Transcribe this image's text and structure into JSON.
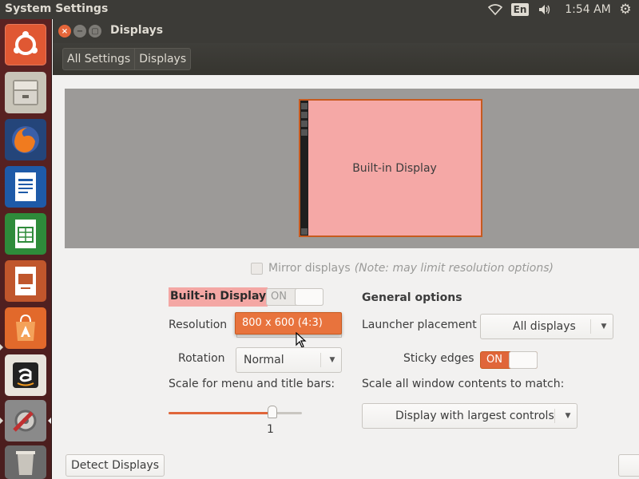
{
  "top_panel": {
    "app_title": "System Settings",
    "language": "En",
    "clock": "1:54 AM",
    "icons": [
      "wifi-icon",
      "volume-icon",
      "power-gear-icon"
    ]
  },
  "launcher": {
    "items": [
      {
        "name": "ubuntu-dash",
        "icon": "ubuntu-logo-icon"
      },
      {
        "name": "files",
        "icon": "file-cabinet-icon"
      },
      {
        "name": "firefox",
        "icon": "firefox-icon"
      },
      {
        "name": "libreoffice-writer",
        "icon": "writer-document-icon"
      },
      {
        "name": "libreoffice-calc",
        "icon": "calc-spreadsheet-icon"
      },
      {
        "name": "libreoffice-impress",
        "icon": "impress-presentation-icon"
      },
      {
        "name": "ubuntu-software",
        "icon": "software-bag-icon"
      },
      {
        "name": "amazon",
        "icon": "amazon-logo-icon"
      },
      {
        "name": "system-settings",
        "icon": "settings-wrench-icon"
      },
      {
        "name": "trash",
        "icon": "trash-icon"
      }
    ]
  },
  "window": {
    "title": "Displays",
    "breadcrumb": [
      "All Settings",
      "Displays"
    ]
  },
  "arrangement": {
    "monitor_label": "Built-in Display"
  },
  "mirror": {
    "label": "Mirror displays",
    "note": "(Note: may limit resolution options)",
    "checked": false
  },
  "display": {
    "name": "Built-in Display",
    "toggle_label": "ON",
    "resolution_label": "Resolution",
    "resolution_value": "800 x 600 (4:3)",
    "rotation_label": "Rotation",
    "rotation_value": "Normal",
    "scale_label": "Scale for menu and title bars:",
    "scale_value": "1",
    "scale_fraction": 0.78
  },
  "general": {
    "title": "General options",
    "launcher_label": "Launcher placement",
    "launcher_value": "All displays",
    "sticky_label": "Sticky edges",
    "sticky_toggle": "ON",
    "scale_all_label": "Scale all window contents to match:",
    "scale_all_value": "Display with largest controls"
  },
  "buttons": {
    "detect": "Detect Displays"
  },
  "colors": {
    "accent": "#e0663a",
    "monitor_fill": "#f5a8a6",
    "panel_dark": "#3c3b37"
  }
}
